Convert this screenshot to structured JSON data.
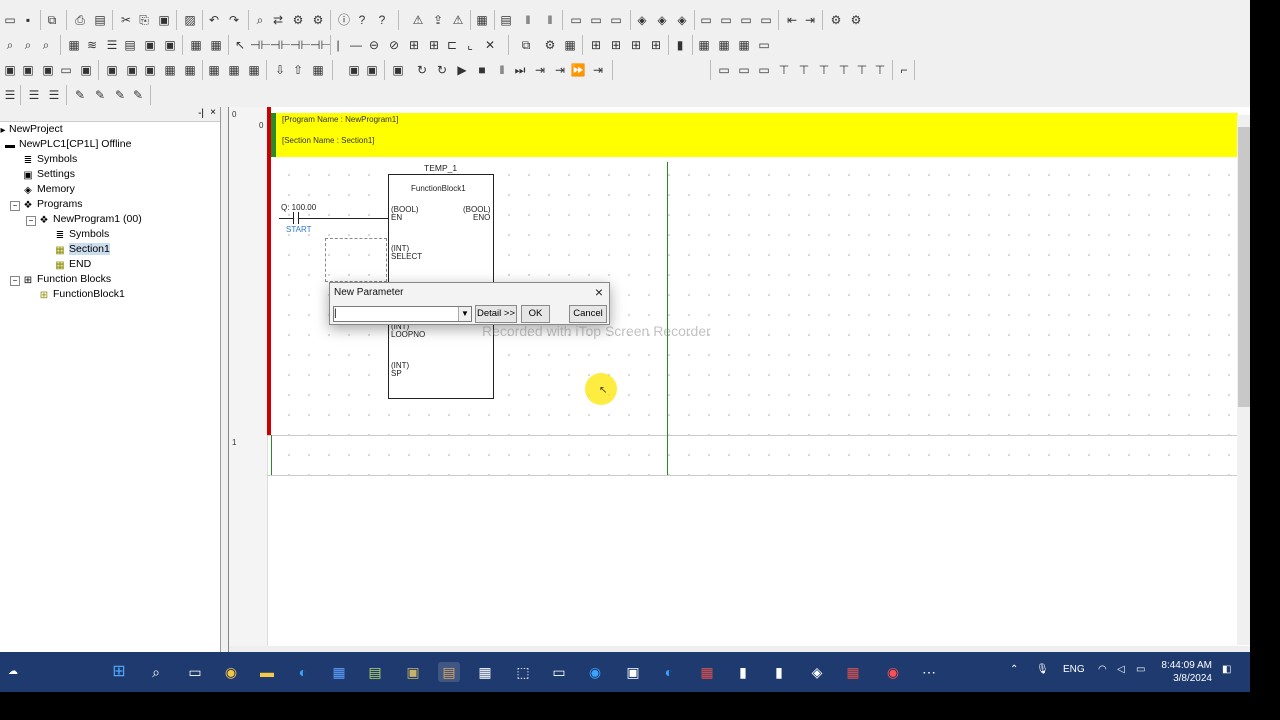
{
  "tree": {
    "items": [
      {
        "label": "NewProject"
      },
      {
        "label": "NewPLC1[CP1L] Offline"
      },
      {
        "label": "Symbols"
      },
      {
        "label": "Settings"
      },
      {
        "label": "Memory"
      },
      {
        "label": "Programs"
      },
      {
        "label": "NewProgram1 (00)"
      },
      {
        "label": "Symbols"
      },
      {
        "label": "Section1"
      },
      {
        "label": "END"
      },
      {
        "label": "Function Blocks"
      },
      {
        "label": "FunctionBlock1"
      }
    ]
  },
  "editor": {
    "rung0_no": "0",
    "rung0_step": "0",
    "rung1_no": "1",
    "program_name": "[Program Name : NewProgram1]",
    "section_name": "[Section Name : Section1]",
    "instance_name": "TEMP_1",
    "contact_address": "Q: 100.00",
    "contact_symbol": "START",
    "fb_name": "FunctionBlock1",
    "pins": {
      "en_type": "(BOOL)",
      "en_name": "EN",
      "eno_type": "(BOOL)",
      "eno_name": "ENO",
      "select_type": "(INT)",
      "select_name": "SELECT",
      "loopno_type": "(INT)",
      "loopno_name": "LOOPNO",
      "sp_type": "(INT)",
      "sp_name": "SP"
    }
  },
  "dialog": {
    "title": "New Parameter",
    "input_value": "|",
    "detail_label": "Detail >>",
    "ok_label": "OK",
    "cancel_label": "Cancel"
  },
  "watermark": "Recorded with iTop Screen Recorder",
  "taskbar": {
    "language": "ENG",
    "time": "8:44:09 AM",
    "date": "3/8/2024"
  }
}
